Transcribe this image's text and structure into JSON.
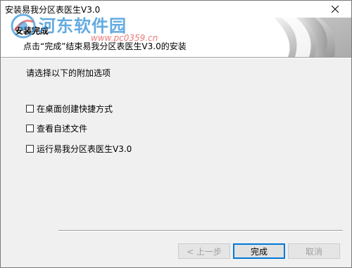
{
  "window": {
    "title": "安装易我分区表医生V3.0"
  },
  "header": {
    "title": "安装完成",
    "subtitle": "点击“完成”结束易我分区表医生V3.0的安装"
  },
  "watermark": {
    "brand": "河东软件园",
    "url": "www.pc0359.cn"
  },
  "content": {
    "prompt": "请选择以下的附加选项",
    "options": [
      {
        "label": "在桌面创建快捷方式",
        "checked": false
      },
      {
        "label": "查看自述文件",
        "checked": false
      },
      {
        "label": "运行易我分区表医生V3.0",
        "checked": false
      }
    ]
  },
  "buttons": {
    "back": "< 上一步",
    "finish": "完成",
    "cancel": "取消"
  },
  "colors": {
    "accent": "#0078d7",
    "watermark_blue": "#2f8fd8",
    "disabled_text": "#a0a0a0"
  }
}
